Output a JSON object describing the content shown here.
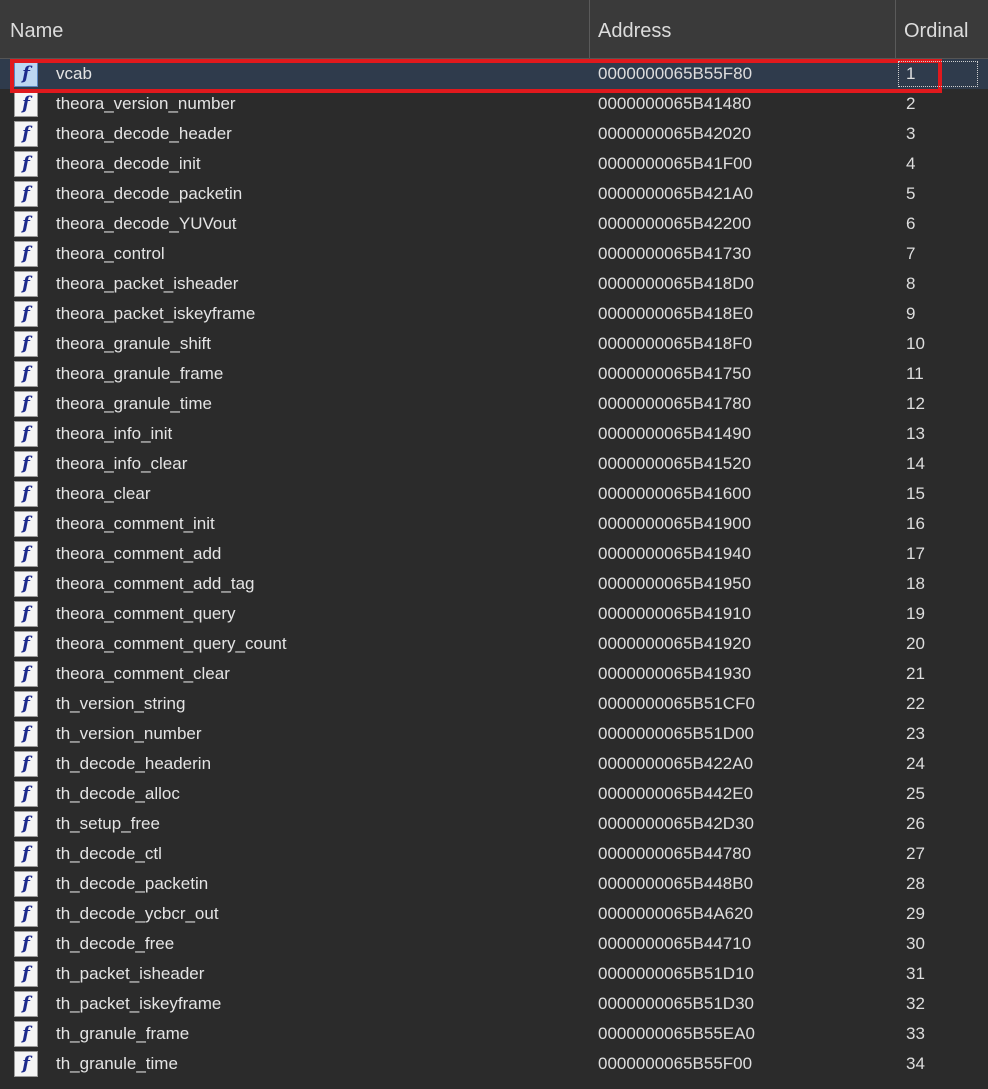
{
  "columns": {
    "name": "Name",
    "address": "Address",
    "ordinal": "Ordinal"
  },
  "selected_index": 0,
  "rows": [
    {
      "name": "vcab",
      "address": "0000000065B55F80",
      "ordinal": "1"
    },
    {
      "name": "theora_version_number",
      "address": "0000000065B41480",
      "ordinal": "2"
    },
    {
      "name": "theora_decode_header",
      "address": "0000000065B42020",
      "ordinal": "3"
    },
    {
      "name": "theora_decode_init",
      "address": "0000000065B41F00",
      "ordinal": "4"
    },
    {
      "name": "theora_decode_packetin",
      "address": "0000000065B421A0",
      "ordinal": "5"
    },
    {
      "name": "theora_decode_YUVout",
      "address": "0000000065B42200",
      "ordinal": "6"
    },
    {
      "name": "theora_control",
      "address": "0000000065B41730",
      "ordinal": "7"
    },
    {
      "name": "theora_packet_isheader",
      "address": "0000000065B418D0",
      "ordinal": "8"
    },
    {
      "name": "theora_packet_iskeyframe",
      "address": "0000000065B418E0",
      "ordinal": "9"
    },
    {
      "name": "theora_granule_shift",
      "address": "0000000065B418F0",
      "ordinal": "10"
    },
    {
      "name": "theora_granule_frame",
      "address": "0000000065B41750",
      "ordinal": "11"
    },
    {
      "name": "theora_granule_time",
      "address": "0000000065B41780",
      "ordinal": "12"
    },
    {
      "name": "theora_info_init",
      "address": "0000000065B41490",
      "ordinal": "13"
    },
    {
      "name": "theora_info_clear",
      "address": "0000000065B41520",
      "ordinal": "14"
    },
    {
      "name": "theora_clear",
      "address": "0000000065B41600",
      "ordinal": "15"
    },
    {
      "name": "theora_comment_init",
      "address": "0000000065B41900",
      "ordinal": "16"
    },
    {
      "name": "theora_comment_add",
      "address": "0000000065B41940",
      "ordinal": "17"
    },
    {
      "name": "theora_comment_add_tag",
      "address": "0000000065B41950",
      "ordinal": "18"
    },
    {
      "name": "theora_comment_query",
      "address": "0000000065B41910",
      "ordinal": "19"
    },
    {
      "name": "theora_comment_query_count",
      "address": "0000000065B41920",
      "ordinal": "20"
    },
    {
      "name": "theora_comment_clear",
      "address": "0000000065B41930",
      "ordinal": "21"
    },
    {
      "name": "th_version_string",
      "address": "0000000065B51CF0",
      "ordinal": "22"
    },
    {
      "name": "th_version_number",
      "address": "0000000065B51D00",
      "ordinal": "23"
    },
    {
      "name": "th_decode_headerin",
      "address": "0000000065B422A0",
      "ordinal": "24"
    },
    {
      "name": "th_decode_alloc",
      "address": "0000000065B442E0",
      "ordinal": "25"
    },
    {
      "name": "th_setup_free",
      "address": "0000000065B42D30",
      "ordinal": "26"
    },
    {
      "name": "th_decode_ctl",
      "address": "0000000065B44780",
      "ordinal": "27"
    },
    {
      "name": "th_decode_packetin",
      "address": "0000000065B448B0",
      "ordinal": "28"
    },
    {
      "name": "th_decode_ycbcr_out",
      "address": "0000000065B4A620",
      "ordinal": "29"
    },
    {
      "name": "th_decode_free",
      "address": "0000000065B44710",
      "ordinal": "30"
    },
    {
      "name": "th_packet_isheader",
      "address": "0000000065B51D10",
      "ordinal": "31"
    },
    {
      "name": "th_packet_iskeyframe",
      "address": "0000000065B51D30",
      "ordinal": "32"
    },
    {
      "name": "th_granule_frame",
      "address": "0000000065B55EA0",
      "ordinal": "33"
    },
    {
      "name": "th_granule_time",
      "address": "0000000065B55F00",
      "ordinal": "34"
    }
  ],
  "row_icon": "function-icon",
  "colors": {
    "background": "#2b2b2b",
    "header": "#3a3a3a",
    "highlight": "#e0191d",
    "selection": "#2f3b4c"
  }
}
